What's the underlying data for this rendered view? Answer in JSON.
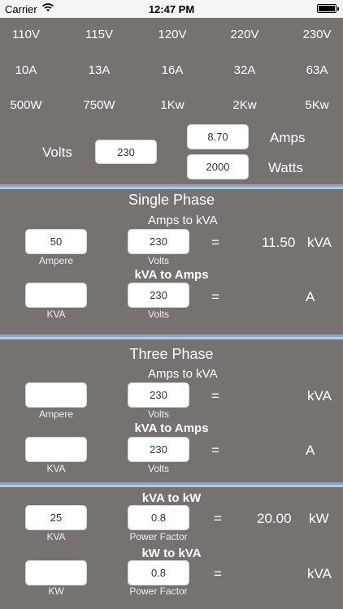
{
  "status": {
    "carrier": "Carrier",
    "time": "12:47 PM"
  },
  "quick": {
    "volts": [
      "110V",
      "115V",
      "120V",
      "220V",
      "230V"
    ],
    "amps": [
      "10A",
      "13A",
      "16A",
      "32A",
      "63A"
    ],
    "watts": [
      "500W",
      "750W",
      "1Kw",
      "2Kw",
      "5Kw"
    ]
  },
  "main": {
    "volts_label": "Volts",
    "volts_value": "230",
    "amps_value": "8.70",
    "amps_label": "Amps",
    "watts_value": "2000",
    "watts_label": "Watts"
  },
  "single": {
    "title": "Single Phase",
    "sub1": "Amps to kVA",
    "a_value": "50",
    "a_label": "Ampere",
    "v1_value": "230",
    "v1_label": "Volts",
    "eq": "=",
    "result1": "11.50",
    "unit1": "kVA",
    "sub2": "kVA to Amps",
    "kva_value": "",
    "kva_label": "KVA",
    "v2_value": "230",
    "v2_label": "Volts",
    "result2": "",
    "unit2": "A"
  },
  "three": {
    "title": "Three Phase",
    "sub1": "Amps to kVA",
    "a_value": "",
    "a_label": "Ampere",
    "v1_value": "230",
    "v1_label": "Volts",
    "eq": "=",
    "result1": "",
    "unit1": "kVA",
    "sub2": "kVA to Amps",
    "kva_value": "",
    "kva_label": "KVA",
    "v2_value": "230",
    "v2_label": "Volts",
    "result2": "",
    "unit2": "A"
  },
  "power": {
    "sub1": "kVA to kW",
    "kva_value": "25",
    "kva_label": "KVA",
    "pf1_value": "0.8",
    "pf1_label": "Power Factor",
    "eq": "=",
    "result1": "20.00",
    "unit1": "kW",
    "sub2": "kW to kVA",
    "kw_value": "",
    "kw_label": "KW",
    "pf2_value": "0.8",
    "pf2_label": "Power Factor",
    "result2": "",
    "unit2": "kVA"
  }
}
